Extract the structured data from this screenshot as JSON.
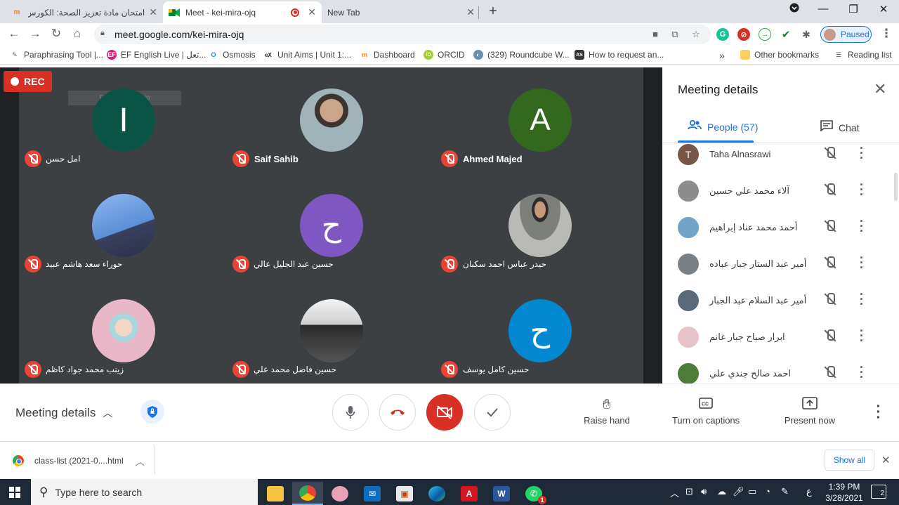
{
  "browser": {
    "tabs": [
      {
        "title": "امتحان مادة تعزيز الصحة: الكورس ال",
        "favicon": "moodle-icon",
        "close": "✕"
      },
      {
        "title": "Meet - kei-mira-ojq",
        "favicon": "meet-icon",
        "close": "✕",
        "recording": true
      },
      {
        "title": "New Tab",
        "close": "✕"
      }
    ],
    "new_tab": "+",
    "url": "meet.google.com/kei-mira-ojq",
    "profile_status": "Paused",
    "bookmarks": [
      "Paraphrasing Tool |...",
      "EF English Live | تعل...",
      "Osmosis",
      "Unit Aims | Unit 1:...",
      "Dashboard",
      "ORCID",
      "(329) Roundcube W...",
      "How to request an..."
    ],
    "bookmark_overflow": "»",
    "other_bookmarks": "Other bookmarks",
    "reading_list": "Reading list"
  },
  "meet": {
    "rec_label": "REC",
    "fullscreen_hint": "Full-screen Snip",
    "participants_grid": [
      {
        "name": "امل حسن",
        "initial": "I",
        "color": "#0b5345",
        "bold": false
      },
      {
        "name": "Saif Sahib",
        "initial": "",
        "photo": "#9fb3b8",
        "bold": true
      },
      {
        "name": "Ahmed Majed",
        "initial": "A",
        "color": "#33691e",
        "bold": true
      },
      {
        "name": "حوراء سعد هاشم عبيد",
        "initial": "",
        "photo": "#5b8fd8",
        "bold": false
      },
      {
        "name": "حسين عبد الجليل عالي",
        "initial": "ح",
        "color": "#7e57c2",
        "bold": false
      },
      {
        "name": "حيدر عباس احمد سكبان",
        "initial": "",
        "photo": "#8a8f86",
        "bold": false
      },
      {
        "name": "زينب محمد جواد كاظم",
        "initial": "",
        "photo": "#e8b7c8",
        "bold": false
      },
      {
        "name": "حسين فاضل محمد علي",
        "initial": "",
        "photo": "#6d6d6d",
        "bold": false
      },
      {
        "name": "حسين كامل يوسف",
        "initial": "ح",
        "color": "#0288d1",
        "bold": false
      }
    ]
  },
  "panel": {
    "title": "Meeting details",
    "close": "✕",
    "people_tab": "People (57)",
    "chat_tab": "Chat",
    "people": [
      {
        "name": "Taha Alnasrawi",
        "initial": "T",
        "color": "#795548"
      },
      {
        "name": "آلاء محمد علي حسين",
        "initial": "",
        "color": "#8d8d8d"
      },
      {
        "name": "أحمد محمد عناد إبراهيم",
        "initial": "",
        "color": "#6fa3c8"
      },
      {
        "name": "أمير عبد الستار جبار عباده",
        "initial": "",
        "color": "#7a7f86"
      },
      {
        "name": "أمير عبد السلام عبد الجبار",
        "initial": "",
        "color": "#5a6a7a"
      },
      {
        "name": "ابرار صباح جبار غانم",
        "initial": "",
        "color": "#e6c3c9"
      },
      {
        "name": "احمد صالح جندي علي",
        "initial": "",
        "color": "#4e7d3a"
      }
    ]
  },
  "controls": {
    "meeting_details": "Meeting details",
    "raise_hand": "Raise hand",
    "captions": "Turn on captions",
    "present": "Present now"
  },
  "download": {
    "file": "class-list (2021-0....html",
    "show_all": "Show all"
  },
  "taskbar": {
    "search_placeholder": "Type here to search",
    "time": "1:39 PM",
    "date": "3/28/2021",
    "input_lang": "ع",
    "notifications": "2",
    "whatsapp_badge": "1"
  }
}
